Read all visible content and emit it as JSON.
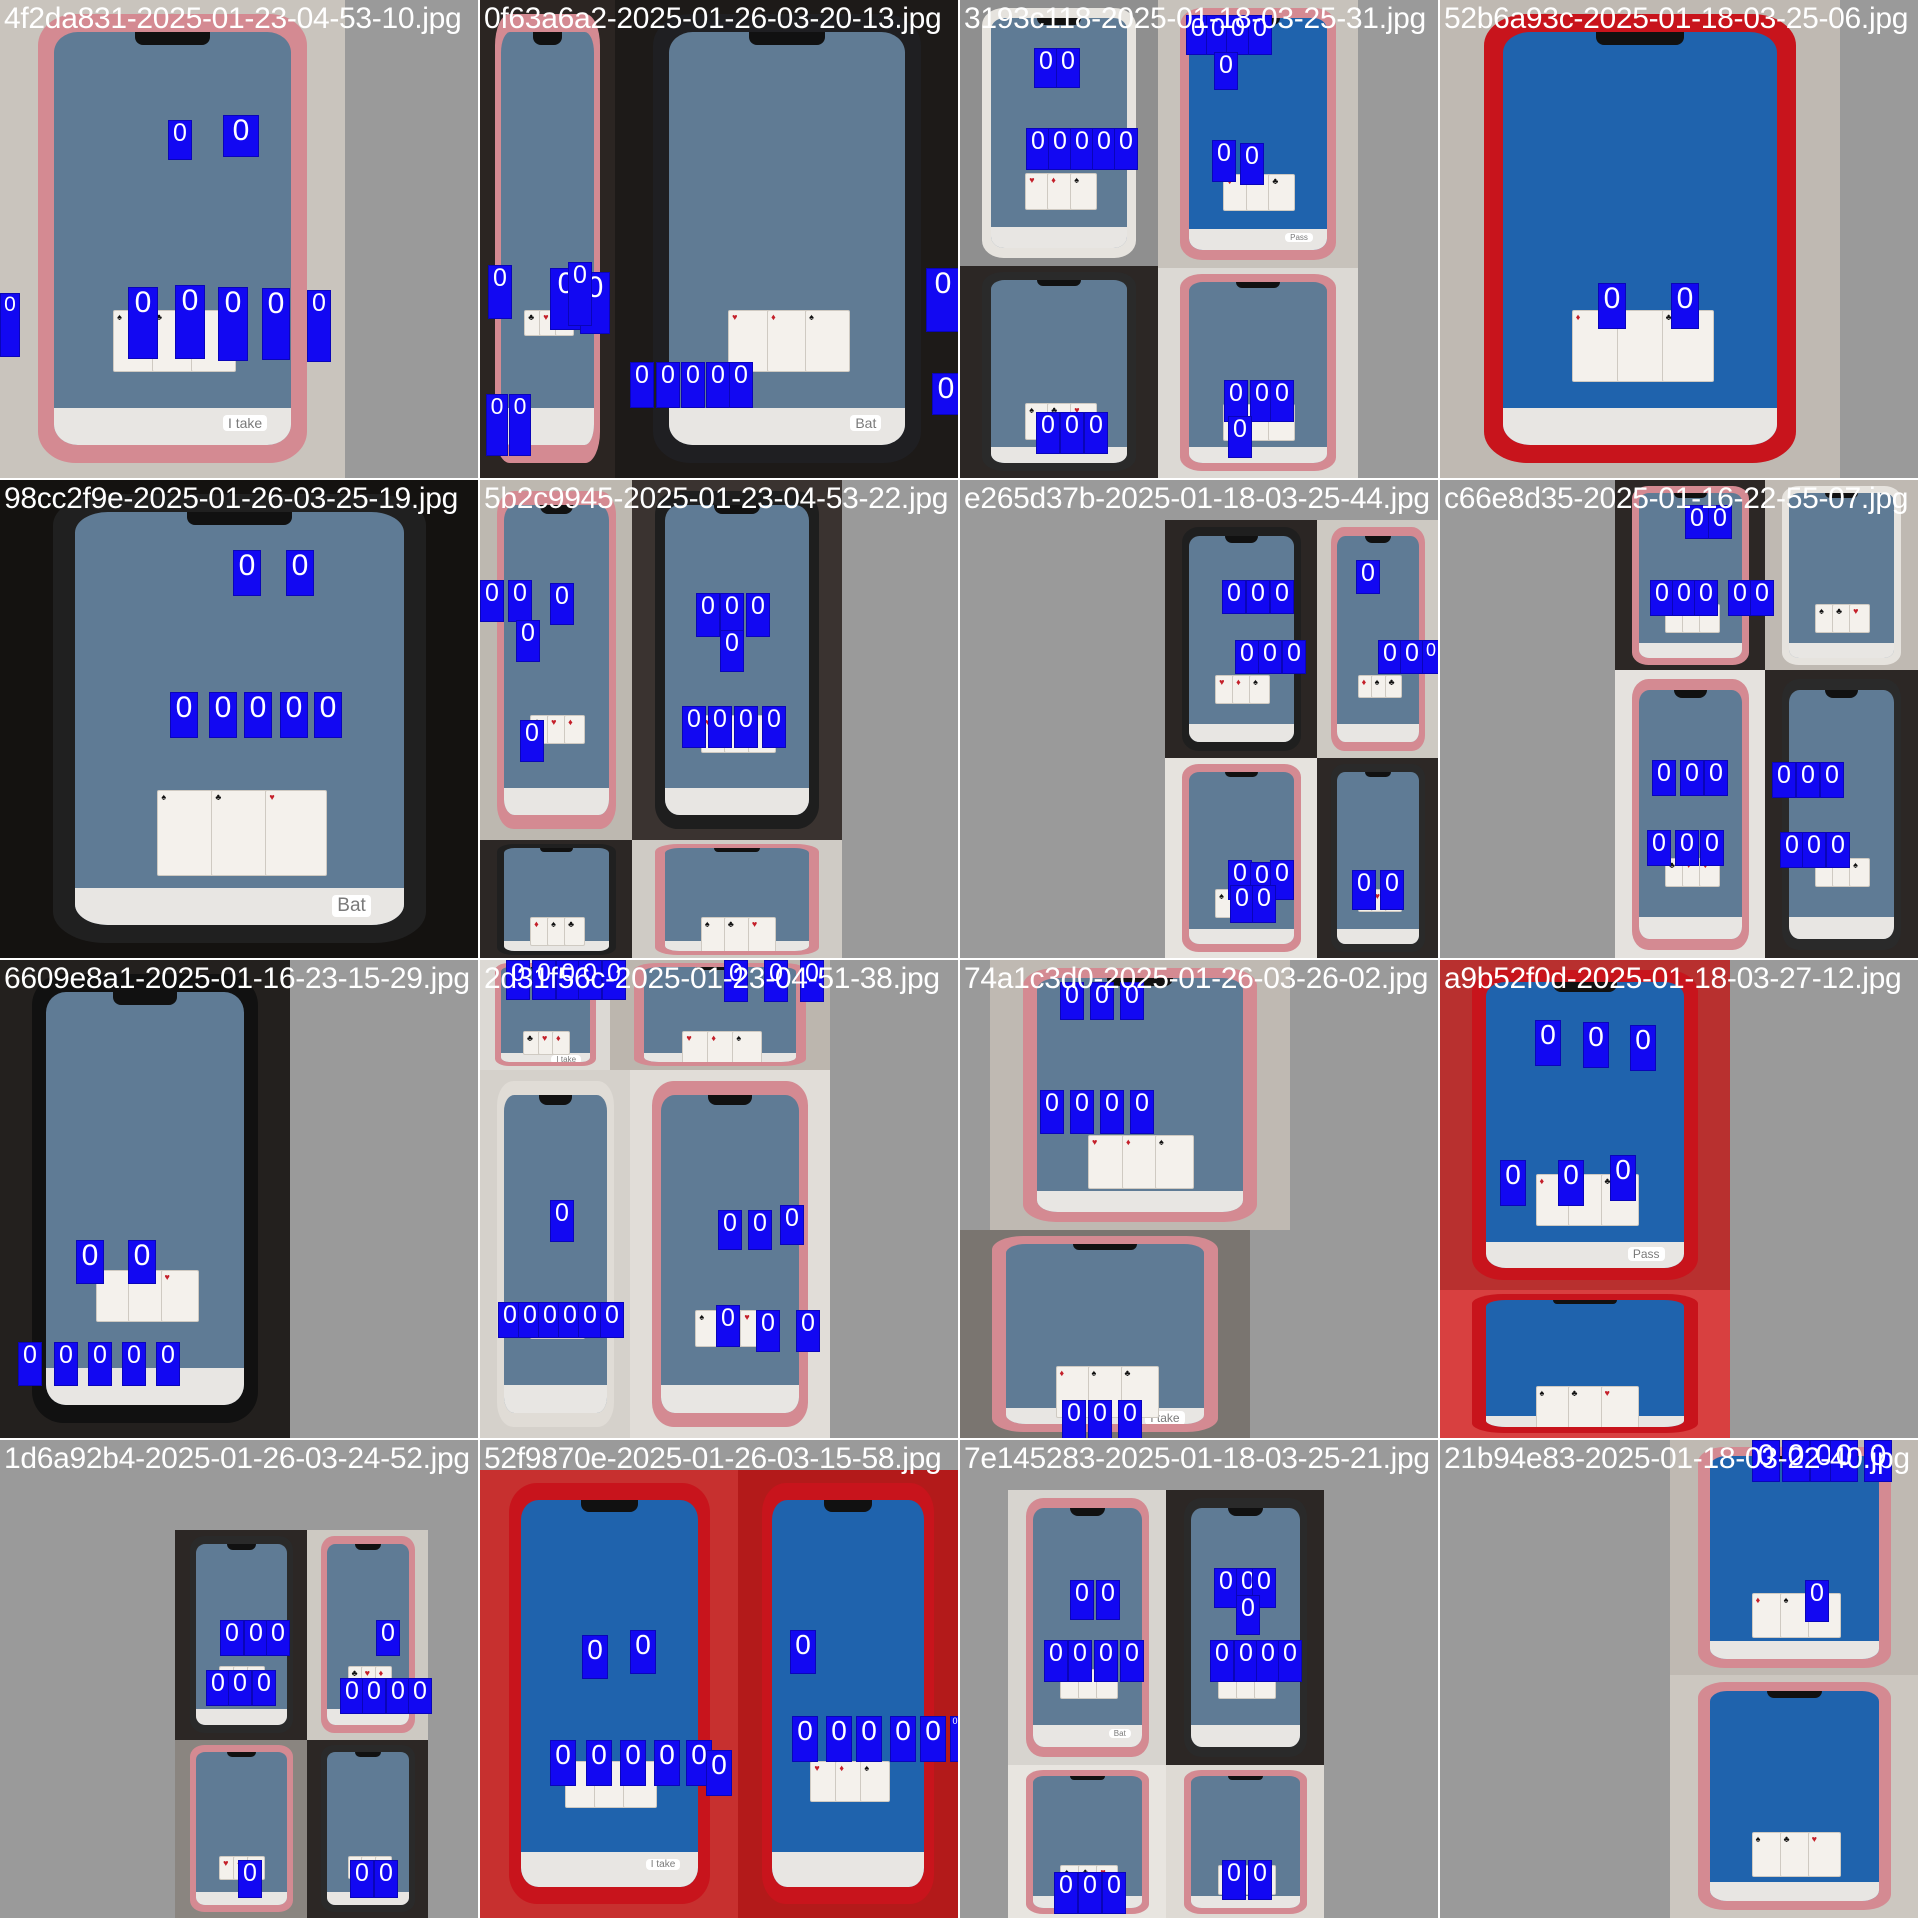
{
  "labels": {
    "detection_class": "0",
    "take_button": "I take",
    "beat_button": "Bat",
    "pass_button": "Pass"
  },
  "colors": {
    "box": "#1208f2",
    "caption_text": "#ffffff",
    "padding_grey": "#9a9a9a",
    "table_grey_blue": "#5f7b95",
    "table_blue": "#1f63ad",
    "phone_pink": "#d48a92",
    "phone_red": "#c8141c"
  },
  "tiles": [
    {
      "caption": "4f2da831-2025-01-23-04-53-10.jpg"
    },
    {
      "caption": "0f63a6a2-2025-01-26-03-20-13.jpg"
    },
    {
      "caption": "3193c118-2025-01-18-03-25-31.jpg"
    },
    {
      "caption": "52b6a93c-2025-01-18-03-25-06.jpg"
    },
    {
      "caption": "98cc2f9e-2025-01-26-03-25-19.jpg"
    },
    {
      "caption": "5b2c9945-2025-01-23-04-53-22.jpg"
    },
    {
      "caption": "e265d37b-2025-01-18-03-25-44.jpg"
    },
    {
      "caption": "c66e8d35-2025-01-16-22-55-07.jpg"
    },
    {
      "caption": "6609e8a1-2025-01-16-23-15-29.jpg"
    },
    {
      "caption": "2d31f56c-2025-01-23-04-51-38.jpg"
    },
    {
      "caption": "74a1c3d0-2025-01-26-03-26-02.jpg"
    },
    {
      "caption": "a9b52f0d-2025-01-18-03-27-12.jpg"
    },
    {
      "caption": "1d6a92b4-2025-01-26-03-24-52.jpg"
    },
    {
      "caption": "52f9870e-2025-01-26-03-15-58.jpg"
    },
    {
      "caption": "7e145283-2025-01-18-03-25-21.jpg"
    },
    {
      "caption": "21b94e83-2025-01-18-03-22-40.jpg"
    }
  ]
}
